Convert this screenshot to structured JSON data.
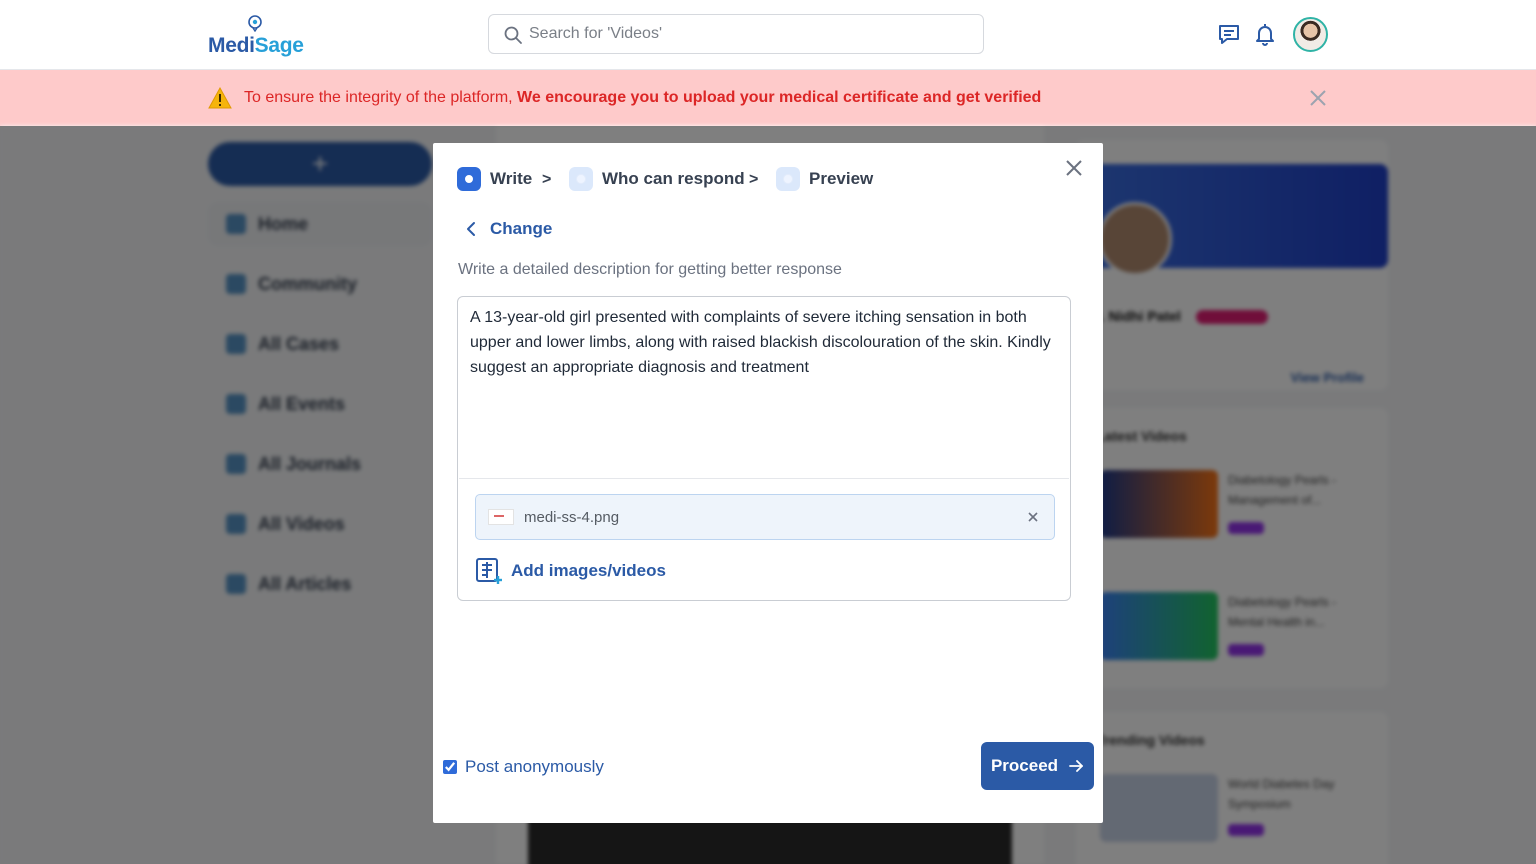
{
  "header": {
    "logo": {
      "part1": "Medi",
      "part2": "Sage"
    },
    "search": {
      "placeholder": "Search for 'Videos'"
    },
    "icons": [
      "chat-icon",
      "bell-icon"
    ]
  },
  "banner": {
    "text_plain": "To ensure the integrity of the platform, ",
    "text_bold": "We encourage you to upload your medical certificate and get verified"
  },
  "background": {
    "add_button": "+",
    "nav": [
      "Home",
      "Community",
      "All Cases",
      "All Events",
      "All Journals",
      "All Videos",
      "All Articles"
    ],
    "profile": {
      "name": "r. Nidhi Patel",
      "view_profile": "View Profile"
    },
    "latest_videos": {
      "title": "Latest Videos",
      "items": [
        "Diabetology Pearls - Management of...",
        "Diabetology Pearls - Mental Health in..."
      ]
    },
    "trending_videos": {
      "title": "Trending Videos",
      "items": [
        "World Diabetes Day Symposium"
      ]
    }
  },
  "modal": {
    "steps": [
      "Write",
      "Who can respond",
      "Preview"
    ],
    "separator": ">",
    "change_label": "Change",
    "hint": "Write a detailed description for getting better response",
    "description": "A 13-year-old girl presented with complaints of severe itching sensation in both upper and lower limbs, along with raised blackish discolouration of the skin. Kindly suggest an appropriate diagnosis and treatment",
    "attachment": {
      "filename": "medi-ss-4.png"
    },
    "add_media_label": "Add images/videos",
    "anonymous_label": "Post anonymously",
    "anonymous_checked": true,
    "proceed_label": "Proceed"
  },
  "colors": {
    "primary": "#2b5aa6",
    "banner_bg": "#fecaca",
    "banner_text": "#dc2626",
    "step_active": "#2f6bd9"
  }
}
